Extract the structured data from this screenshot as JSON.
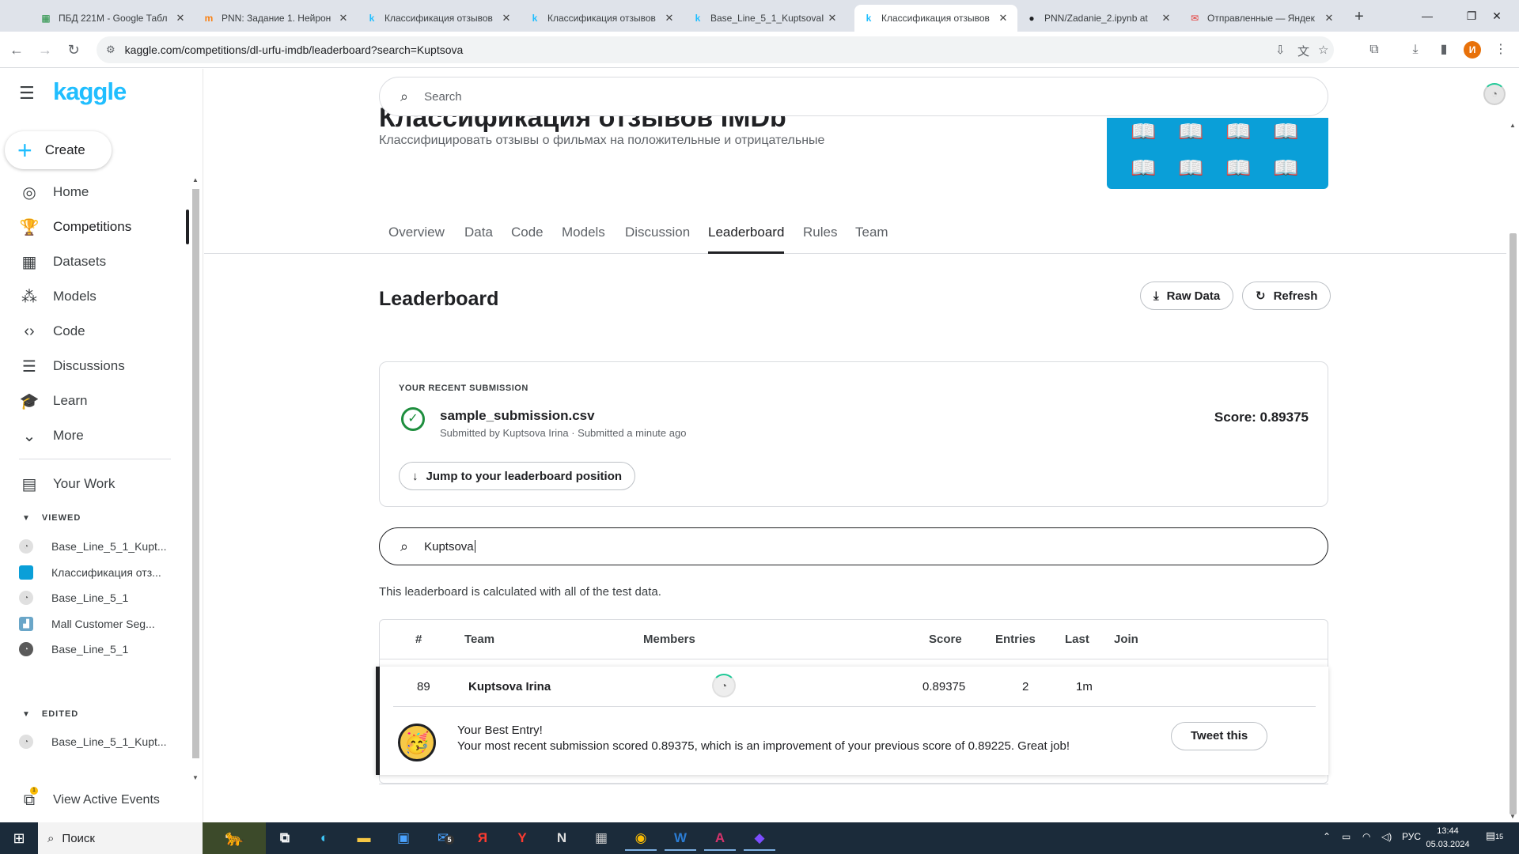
{
  "browser": {
    "tabs": [
      {
        "label": "ПБД 221М - Google Табл",
        "icon": "sheets-icon",
        "color": "#1e8e3e",
        "glyph": "▦"
      },
      {
        "label": "PNN: Задание 1. Нейрон",
        "icon": "moodle-icon",
        "color": "#f98012",
        "glyph": "m"
      },
      {
        "label": "Классификация отзывов",
        "icon": "kaggle-icon",
        "color": "#20beff",
        "glyph": "k"
      },
      {
        "label": "Классификация отзывов",
        "icon": "kaggle-icon",
        "color": "#20beff",
        "glyph": "k"
      },
      {
        "label": "Base_Line_5_1_KuptsovaI",
        "icon": "kaggle-icon",
        "color": "#20beff",
        "glyph": "k"
      },
      {
        "label": "Классификация отзывов",
        "icon": "kaggle-icon",
        "color": "#20beff",
        "glyph": "k"
      },
      {
        "label": "PNN/Zadanie_2.ipynb at",
        "icon": "github-icon",
        "color": "#202124",
        "glyph": "●"
      },
      {
        "label": "Отправленные — Яндек",
        "icon": "yandex-mail-icon",
        "color": "#e53935",
        "glyph": "✉"
      }
    ],
    "active_tab": 5,
    "url": "kaggle.com/competitions/dl-urfu-imdb/leaderboard?search=Kuptsova",
    "profile_letter": "И"
  },
  "sidebar": {
    "logo": "kaggle",
    "create_label": "Create",
    "nav": [
      {
        "label": "Home",
        "icon": "compass-icon",
        "glyph": "◎"
      },
      {
        "label": "Competitions",
        "icon": "trophy-icon",
        "glyph": "🏆"
      },
      {
        "label": "Datasets",
        "icon": "table-icon",
        "glyph": "▦"
      },
      {
        "label": "Models",
        "icon": "models-icon",
        "glyph": "⁂"
      },
      {
        "label": "Code",
        "icon": "code-icon",
        "glyph": "‹›"
      },
      {
        "label": "Discussions",
        "icon": "discussion-icon",
        "glyph": "☰"
      },
      {
        "label": "Learn",
        "icon": "school-icon",
        "glyph": "🎓"
      },
      {
        "label": "More",
        "icon": "chevron-down-icon",
        "glyph": "⌄"
      }
    ],
    "your_work": "Your Work",
    "viewed_heading": "VIEWED",
    "viewed": [
      {
        "label": "Base_Line_5_1_Kupt..."
      },
      {
        "label": "Классификация отз..."
      },
      {
        "label": "Base_Line_5_1"
      },
      {
        "label": "Mall Customer Seg..."
      },
      {
        "label": "Base_Line_5_1"
      }
    ],
    "edited_heading": "EDITED",
    "edited": [
      {
        "label": "Base_Line_5_1_Kupt..."
      }
    ],
    "events_label": "View Active Events",
    "events_badge": "1"
  },
  "main": {
    "search_placeholder": "Search",
    "comp_title": "Классификация отзывов IMDb",
    "comp_subtitle": "Классифицировать отзывы о фильмах на положительные и отрицательные",
    "tabs": [
      "Overview",
      "Data",
      "Code",
      "Models",
      "Discussion",
      "Leaderboard",
      "Rules",
      "Team"
    ],
    "active_tab": "Leaderboard",
    "lb_title": "Leaderboard",
    "raw_data_label": "Raw Data",
    "refresh_label": "Refresh",
    "submission": {
      "kicker": "YOUR RECENT SUBMISSION",
      "filename": "sample_submission.csv",
      "meta": "Submitted by Kuptsova Irina · Submitted a minute ago",
      "score": "Score: 0.89375",
      "jump_label": "Jump to your leaderboard position"
    },
    "lb_search_value": "Kuptsova",
    "calc_note": "This leaderboard is calculated with all of the test data.",
    "table": {
      "headers": {
        "rank": "#",
        "team": "Team",
        "members": "Members",
        "score": "Score",
        "entries": "Entries",
        "last": "Last",
        "join": "Join"
      },
      "row": {
        "rank": "89",
        "team": "Kuptsova Irina",
        "score": "0.89375",
        "entries": "2",
        "last": "1m"
      },
      "best_title": "Your Best Entry!",
      "best_text": "Your most recent submission scored 0.89375, which is an improvement of your previous score of 0.89225. Great job!",
      "tweet_label": "Tweet this"
    }
  },
  "taskbar": {
    "search_label": "Поиск",
    "lang": "РУС",
    "time": "13:44",
    "date": "05.03.2024",
    "mail_badge": "5",
    "notif_count": "15"
  }
}
